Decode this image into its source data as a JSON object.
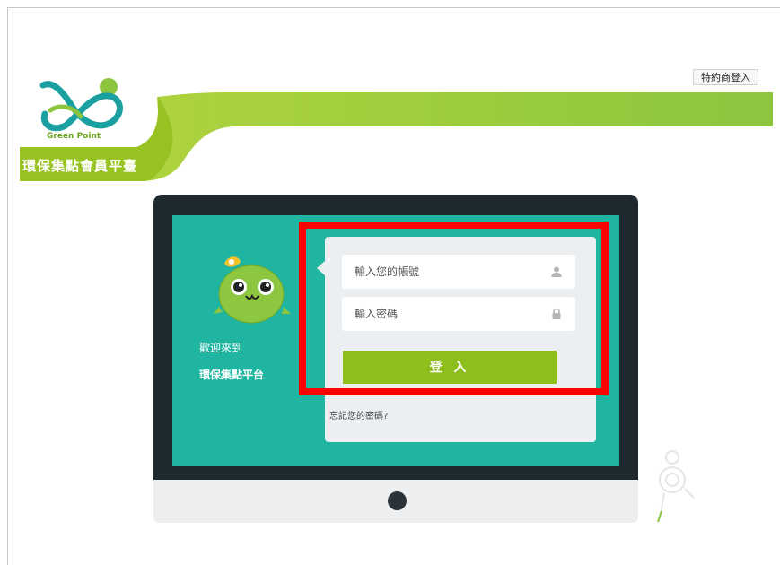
{
  "header": {
    "partner_login": "特約商登入",
    "logo_text": "Green Point",
    "platform_title": "環保集點會員平臺"
  },
  "welcome": {
    "line1": "歡迎來到",
    "line2": "環保集點平台"
  },
  "login_form": {
    "account_placeholder": "輸入您的帳號",
    "password_placeholder": "輸入密碼",
    "submit_label": "登 入",
    "forgot_password": "忘記您的密碼?"
  },
  "colors": {
    "brand_green": "#8dbe1c",
    "screen_teal": "#1fb5a0",
    "highlight": "#ff0000"
  }
}
